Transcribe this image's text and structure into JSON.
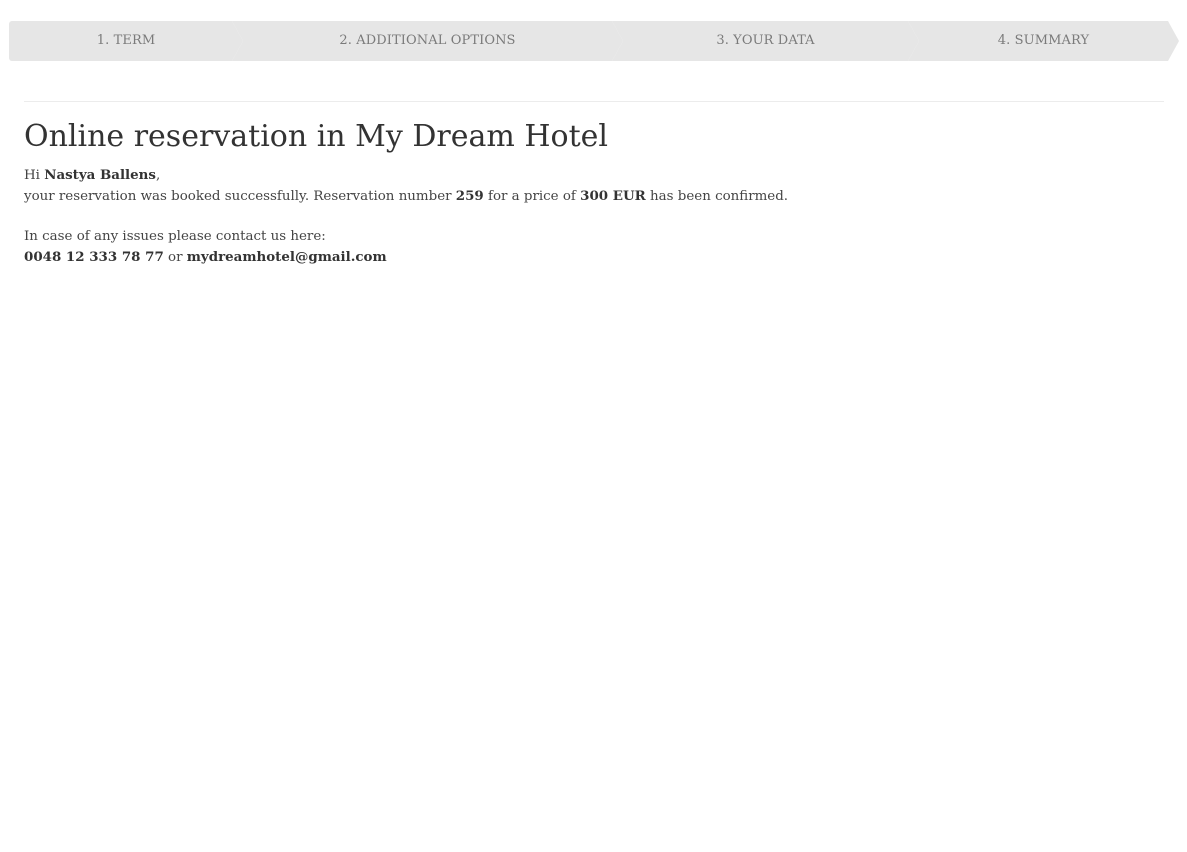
{
  "steps": [
    {
      "label": "1. TERM"
    },
    {
      "label": "2. ADDITIONAL OPTIONS"
    },
    {
      "label": "3. YOUR DATA"
    },
    {
      "label": "4. SUMMARY"
    }
  ],
  "page": {
    "title": "Online reservation in My Dream Hotel"
  },
  "confirmation": {
    "greeting_prefix": "Hi ",
    "guest_name": "Nastya Ballens",
    "greeting_suffix": ",",
    "booked_text": "your reservation was booked successfully. Reservation number ",
    "reservation_number": "259",
    "price_prefix": " for a price of ",
    "price": "300 EUR",
    "confirmed_text": " has been confirmed."
  },
  "contact": {
    "intro": "In case of any issues please contact us here:",
    "phone": "0048 12 333 78 77",
    "separator": " or ",
    "email": "mydreamhotel@gmail.com"
  }
}
